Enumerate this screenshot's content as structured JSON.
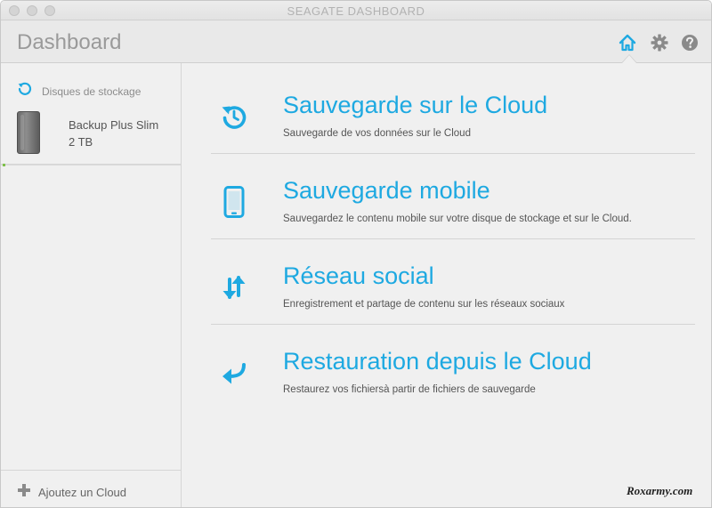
{
  "window": {
    "title": "SEAGATE DASHBOARD"
  },
  "header": {
    "title": "Dashboard",
    "icons": [
      "home-icon",
      "gear-icon",
      "help-icon"
    ]
  },
  "sidebar": {
    "storage_label": "Disques de stockage",
    "device": {
      "name": "Backup Plus Slim",
      "size": "2 TB"
    },
    "footer_label": "Ajoutez un Cloud"
  },
  "actions": [
    {
      "icon": "cloud-backup-icon",
      "title": "Sauvegarde sur le Cloud",
      "description": "Sauvegarde de vos données sur le Cloud"
    },
    {
      "icon": "mobile-icon",
      "title": "Sauvegarde mobile",
      "description": "Sauvegardez le contenu mobile sur votre disque de stockage et sur le Cloud."
    },
    {
      "icon": "social-sync-icon",
      "title": "Réseau social",
      "description": "Enregistrement et partage de contenu sur les réseaux sociaux"
    },
    {
      "icon": "restore-icon",
      "title": "Restauration depuis le Cloud",
      "description": "Restaurez vos fichiersà partir de fichiers de sauvegarde"
    }
  ],
  "watermark": "Roxarmy.com",
  "colors": {
    "accent": "#1ea9e1",
    "text_muted": "#9a9a9a"
  }
}
